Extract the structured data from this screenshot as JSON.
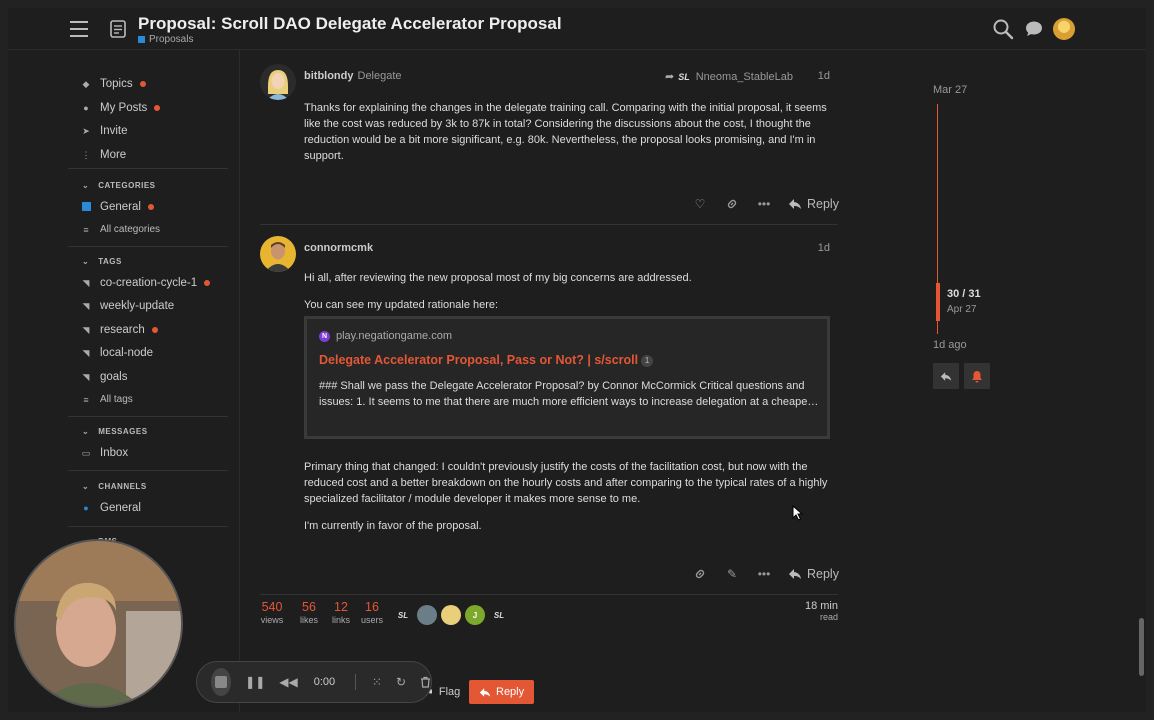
{
  "header": {
    "title": "Proposal: Scroll DAO Delegate Accelerator Proposal",
    "category": "Proposals",
    "category_color": "#2a8ad8"
  },
  "sidebar": {
    "items": [
      {
        "label": "Topics",
        "icon": "layers-icon",
        "unread": true
      },
      {
        "label": "My Posts",
        "icon": "user-icon",
        "unread": true
      },
      {
        "label": "Invite",
        "icon": "send-icon",
        "unread": false
      },
      {
        "label": "More",
        "icon": "more-vertical-icon",
        "unread": false
      }
    ],
    "categories_heading": "CATEGORIES",
    "categories": [
      {
        "label": "General",
        "color": "#2a8ad8",
        "unread": true
      },
      {
        "label": "All categories"
      }
    ],
    "tags_heading": "TAGS",
    "tags": [
      {
        "label": "co-creation-cycle-1",
        "unread": true
      },
      {
        "label": "weekly-update",
        "unread": false
      },
      {
        "label": "research",
        "unread": true
      },
      {
        "label": "local-node",
        "unread": false
      },
      {
        "label": "goals",
        "unread": false
      },
      {
        "label": "All tags",
        "unread": false
      }
    ],
    "messages_heading": "MESSAGES",
    "messages": [
      {
        "label": "Inbox"
      }
    ],
    "channels_heading": "CHANNELS",
    "channels": [
      {
        "label": "General"
      }
    ],
    "dms_heading": "DMS"
  },
  "posts": [
    {
      "username": "bitblondy",
      "user_title": "Delegate",
      "reply_to": "Nneoma_StableLab",
      "date": "1d",
      "paragraphs": [
        "Thanks for explaining the changes in the delegate training call. Comparing with the initial proposal, it seems like the cost was reduced by 3k to 87k in total? Considering the discussions about the cost, I thought the reduction would be a bit more significant, e.g. 80k. Nevertheless, the proposal looks promising, and I'm in support."
      ],
      "reply_label": "Reply"
    },
    {
      "username": "connormcmk",
      "date": "1d",
      "paragraphs": [
        "Hi all, after reviewing the new proposal most of my big concerns are addressed.",
        "You can see my updated rationale here:",
        "Primary thing that changed: I couldn't previously justify the costs of the facilitation cost, but now with the reduced cost and a better breakdown on the hourly costs and after comparing to the typical rates of a highly specialized facilitator / module developer it makes more sense to me.",
        "I'm currently in favor of the proposal."
      ],
      "onebox": {
        "source": "play.negationgame.com",
        "title": "Delegate Accelerator Proposal, Pass or Not? | s/scroll",
        "click_count": "1",
        "excerpt": "### Shall we pass the Delegate Accelerator Proposal? by Connor McCormick Critical questions and issues: 1. It seems to me that there are much more efficient ways to increase delegation at a cheape…"
      },
      "reply_label": "Reply"
    }
  ],
  "stats": {
    "views": "540",
    "views_label": "views",
    "likes": "56",
    "likes_label": "likes",
    "links": "12",
    "links_label": "links",
    "users": "16",
    "users_label": "users",
    "read_time": "18 min",
    "read_label": "read"
  },
  "participants": [
    "SL",
    "",
    "",
    "J",
    "SL"
  ],
  "bottom": {
    "flag_label": "Flag",
    "reply_label": "Reply"
  },
  "timeline": {
    "top_date": "Mar 27",
    "position": "30 / 31",
    "position_date": "Apr 27",
    "last_activity": "1d ago"
  },
  "recorder": {
    "time": "0:00"
  },
  "colors": {
    "accent": "#e45735",
    "background": "#1e1e1e",
    "category_blue": "#2a8ad8"
  }
}
